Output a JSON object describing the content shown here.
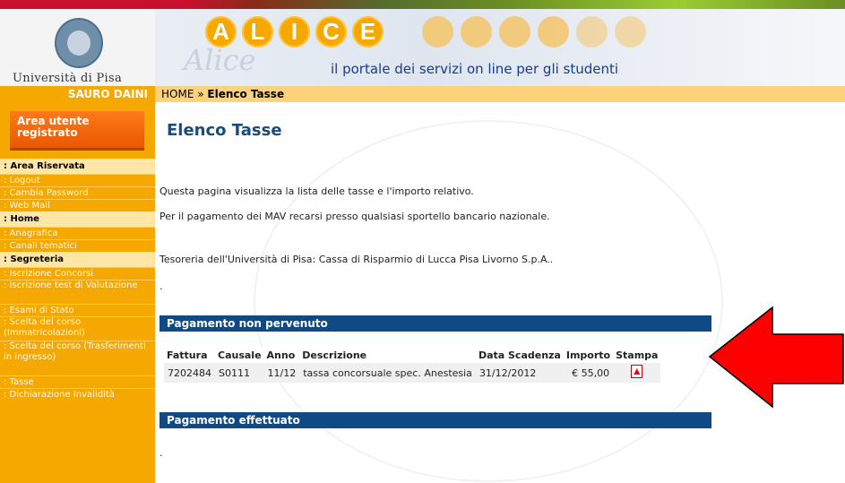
{
  "header": {
    "university_name": "Università di Pisa",
    "alice_letters": [
      "A",
      "L",
      "I",
      "C",
      "E"
    ],
    "alice_script": "Alice",
    "tagline": "il portale dei servizi on line per gli studenti"
  },
  "user_bar": {
    "user_name": "SAURO DAINI"
  },
  "breadcrumb": {
    "home": "HOME",
    "separator": " » ",
    "current": "Elenco Tasse"
  },
  "sidebar": {
    "area_button": "Area utente registrato",
    "sections": [
      {
        "title": ": Area Riservata",
        "items": [
          ": Logout",
          ": Cambia Password",
          ": Web Mail"
        ]
      },
      {
        "title": ": Home",
        "items": [
          ": Anagrafica",
          ": Canali tematici"
        ]
      },
      {
        "title": ": Segreteria",
        "items": [
          ": Iscrizione Concorsi",
          ": Iscrizione test di Valutazione",
          ": Esami di Stato",
          ": Scelta del corso (Immatricolazioni)",
          ": Scelta del corso (Trasferimenti in ingresso)",
          ": Tasse",
          ": Dichiarazione Invalidità"
        ]
      }
    ]
  },
  "main": {
    "title": "Elenco Tasse",
    "intro": "Questa pagina visualizza la lista delle tasse e l'importo relativo.",
    "mav_note": "Per il pagamento dei MAV recarsi presso qualsiasi sportello bancario nazionale.",
    "tesoreria": "Tesoreria dell'Università di Pisa: Cassa di Risparmio di Lucca Pisa Livorno S.p.A..",
    "dot1": ".",
    "pending_header": "Pagamento non pervenuto",
    "table": {
      "headers": [
        "Fattura",
        "Causale",
        "Anno",
        "Descrizione",
        "Data Scadenza",
        "Importo",
        "Stampa"
      ],
      "rows": [
        {
          "fattura": "7202484",
          "causale": "S0111",
          "anno": "11/12",
          "descrizione": "tassa concorsuale spec. Anestesia",
          "scadenza": "31/12/2012",
          "importo": "€ 55,00"
        }
      ]
    },
    "paid_header": "Pagamento effettuato",
    "dot2": "."
  },
  "colors": {
    "accent_orange": "#f5a800",
    "section_blue": "#104a85",
    "arrow_red": "#ff0000"
  },
  "icons": {
    "print": "pdf-icon",
    "seal": "university-seal-icon",
    "arrow": "red-arrow-icon"
  }
}
